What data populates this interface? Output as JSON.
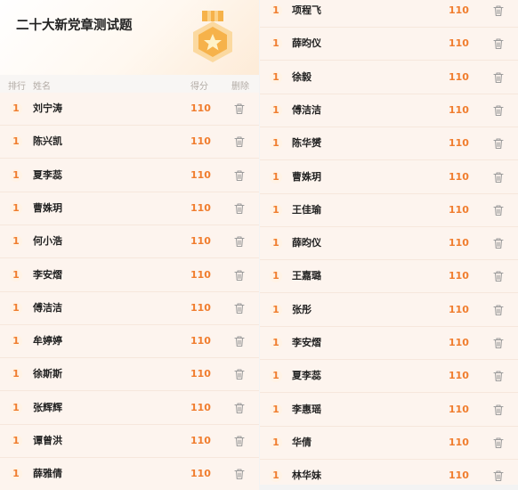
{
  "quiz": {
    "title": "二十大新党章测试题"
  },
  "columns": {
    "rank": "排行",
    "name": "姓名",
    "score": "得分",
    "delete": "删除"
  },
  "colors": {
    "accent": "#f07d2e",
    "medal": "#f4a43a"
  },
  "left_rows": [
    {
      "rank": "1",
      "name": "刘宁涛",
      "score": "110"
    },
    {
      "rank": "1",
      "name": "陈兴凯",
      "score": "110"
    },
    {
      "rank": "1",
      "name": "夏李蕊",
      "score": "110"
    },
    {
      "rank": "1",
      "name": "曹姝玥",
      "score": "110"
    },
    {
      "rank": "1",
      "name": "何小浩",
      "score": "110"
    },
    {
      "rank": "1",
      "name": "李安熠",
      "score": "110"
    },
    {
      "rank": "1",
      "name": "傅洁洁",
      "score": "110"
    },
    {
      "rank": "1",
      "name": "牟婷婷",
      "score": "110"
    },
    {
      "rank": "1",
      "name": "徐斯斯",
      "score": "110"
    },
    {
      "rank": "1",
      "name": "张辉辉",
      "score": "110"
    },
    {
      "rank": "1",
      "name": "谭曾洪",
      "score": "110"
    },
    {
      "rank": "1",
      "name": "薛雅倩",
      "score": "110"
    }
  ],
  "right_rows": [
    {
      "rank": "1",
      "name": "项程飞",
      "score": "110"
    },
    {
      "rank": "1",
      "name": "薛昀仪",
      "score": "110"
    },
    {
      "rank": "1",
      "name": "徐毅",
      "score": "110"
    },
    {
      "rank": "1",
      "name": "傅洁洁",
      "score": "110"
    },
    {
      "rank": "1",
      "name": "陈华赟",
      "score": "110"
    },
    {
      "rank": "1",
      "name": "曹姝玥",
      "score": "110"
    },
    {
      "rank": "1",
      "name": "王佳瑜",
      "score": "110"
    },
    {
      "rank": "1",
      "name": "薛昀仪",
      "score": "110"
    },
    {
      "rank": "1",
      "name": "王嘉璐",
      "score": "110"
    },
    {
      "rank": "1",
      "name": "张彤",
      "score": "110"
    },
    {
      "rank": "1",
      "name": "李安熠",
      "score": "110"
    },
    {
      "rank": "1",
      "name": "夏李蕊",
      "score": "110"
    },
    {
      "rank": "1",
      "name": "李惠瑶",
      "score": "110"
    },
    {
      "rank": "1",
      "name": "华倩",
      "score": "110"
    },
    {
      "rank": "1",
      "name": "林华妹",
      "score": "110"
    }
  ]
}
